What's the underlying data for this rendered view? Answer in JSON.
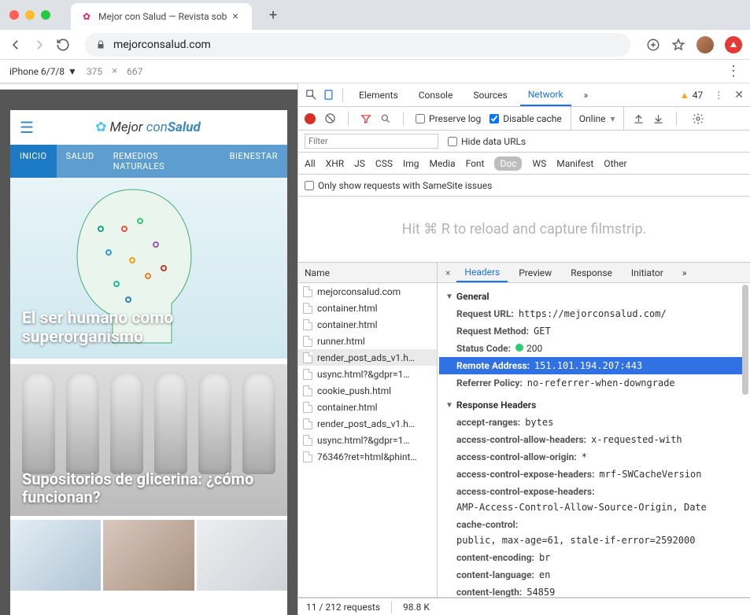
{
  "browser": {
    "tab_title": "Mejor con Salud — Revista sob",
    "url": "mejorconsalud.com",
    "new_tab": "+"
  },
  "device_bar": {
    "device": "iPhone 6/7/8",
    "width": "375",
    "height": "667"
  },
  "site": {
    "brand_prefix": "Mejor",
    "brand_mid": "con",
    "brand_suffix": "Salud",
    "tabs": [
      "INICIO",
      "SALUD",
      "REMEDIOS NATURALES",
      "BIENESTAR"
    ],
    "hero_title": "El ser humano como superorganismo",
    "card2_title": "Supositorios de glicerina: ¿cómo funcionan?"
  },
  "devtools": {
    "tabs": [
      "Elements",
      "Console",
      "Sources",
      "Network"
    ],
    "active_tab": "Network",
    "warnings": "47",
    "preserve_log": "Preserve log",
    "disable_cache": "Disable cache",
    "online": "Online",
    "filter_placeholder": "Filter",
    "hide_data_urls": "Hide data URLs",
    "types": [
      "All",
      "XHR",
      "JS",
      "CSS",
      "Img",
      "Media",
      "Font",
      "Doc",
      "WS",
      "Manifest",
      "Other"
    ],
    "active_type": "Doc",
    "samesite": "Only show requests with SameSite issues",
    "filmstrip_hint": "Hit ⌘ R to reload and capture filmstrip.",
    "name_header": "Name",
    "requests": [
      "mejorconsalud.com",
      "container.html",
      "container.html",
      "runner.html",
      "render_post_ads_v1.h…",
      "usync.html?&gdpr=1…",
      "cookie_push.html",
      "container.html",
      "render_post_ads_v1.h…",
      "usync.html?&gdpr=1…",
      "76346?ret=html&phint…"
    ],
    "selected_request_index": 4,
    "detail_tabs": [
      "Headers",
      "Preview",
      "Response",
      "Initiator"
    ],
    "active_detail_tab": "Headers",
    "general_label": "General",
    "general": {
      "request_url_k": "Request URL:",
      "request_url_v": "https://mejorconsalud.com/",
      "request_method_k": "Request Method:",
      "request_method_v": "GET",
      "status_code_k": "Status Code:",
      "status_code_v": "200",
      "remote_address_k": "Remote Address:",
      "remote_address_v": "151.101.194.207:443",
      "referrer_policy_k": "Referrer Policy:",
      "referrer_policy_v": "no-referrer-when-downgrade"
    },
    "response_headers_label": "Response Headers",
    "response_headers": [
      {
        "k": "accept-ranges:",
        "v": "bytes"
      },
      {
        "k": "access-control-allow-headers:",
        "v": "x-requested-with"
      },
      {
        "k": "access-control-allow-origin:",
        "v": "*"
      },
      {
        "k": "access-control-expose-headers:",
        "v": "mrf-SWCacheVersion"
      },
      {
        "k": "access-control-expose-headers:",
        "v": "AMP-Access-Control-Allow-Source-Origin, Date"
      },
      {
        "k": "cache-control:",
        "v": "public, max-age=61, stale-if-error=2592000"
      },
      {
        "k": "content-encoding:",
        "v": "br"
      },
      {
        "k": "content-language:",
        "v": "en"
      },
      {
        "k": "content-length:",
        "v": "54859"
      }
    ],
    "status_requests": "11 / 212 requests",
    "status_transferred": "98.8 K"
  }
}
